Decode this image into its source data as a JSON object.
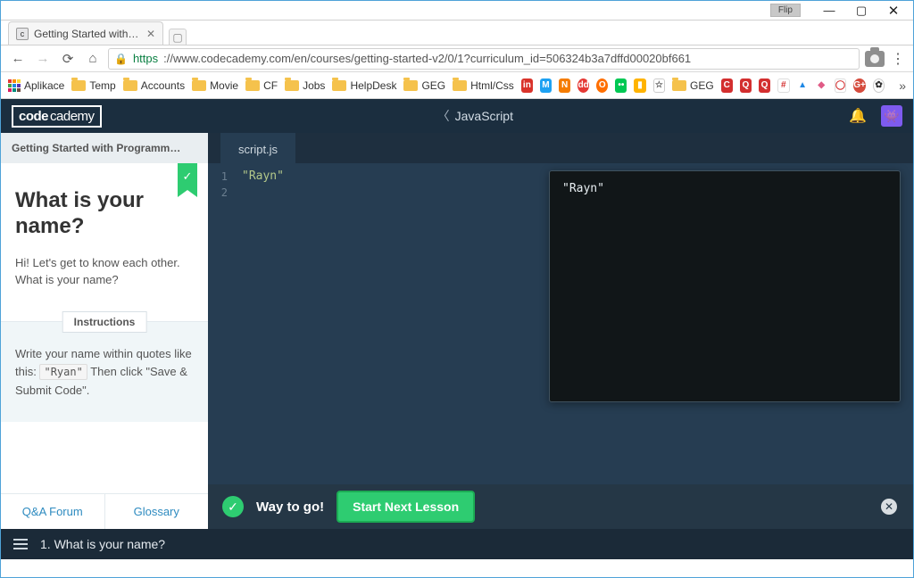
{
  "os": {
    "flip": "Flip"
  },
  "browser": {
    "tab_title": "Getting Started with Prog…",
    "url_https": "https",
    "url_rest": "://www.codecademy.com/en/courses/getting-started-v2/0/1?curriculum_id=506324b3a7dffd00020bf661",
    "bookmarks": {
      "apps": "Aplikace",
      "folders": [
        "Temp",
        "Accounts",
        "Movie",
        "CF",
        "Jobs",
        "HelpDesk",
        "GEG",
        "Html/Css"
      ],
      "geg2": "GEG"
    }
  },
  "app": {
    "brand_left": "code",
    "brand_right": "cademy",
    "center_label": "JavaScript",
    "crumb": "Getting Started with Programm…",
    "lesson_title": "What is your name?",
    "lesson_text": "Hi! Let's get to know each other. What is your name?",
    "instructions_label": "Instructions",
    "instructions_pre": "Write your name within quotes like this: ",
    "instructions_code": "\"Ryan\"",
    "instructions_post": " Then click \"Save & Submit Code\".",
    "footer_qa": "Q&A Forum",
    "footer_glossary": "Glossary",
    "file_tab": "script.js",
    "editor_line1": "\"Rayn\"",
    "gutter": [
      "1",
      "2"
    ],
    "console_out": "\"Rayn\"",
    "status_way": "Way to go!",
    "start_next": "Start Next Lesson",
    "bottom_label": "1. What is your name?"
  }
}
